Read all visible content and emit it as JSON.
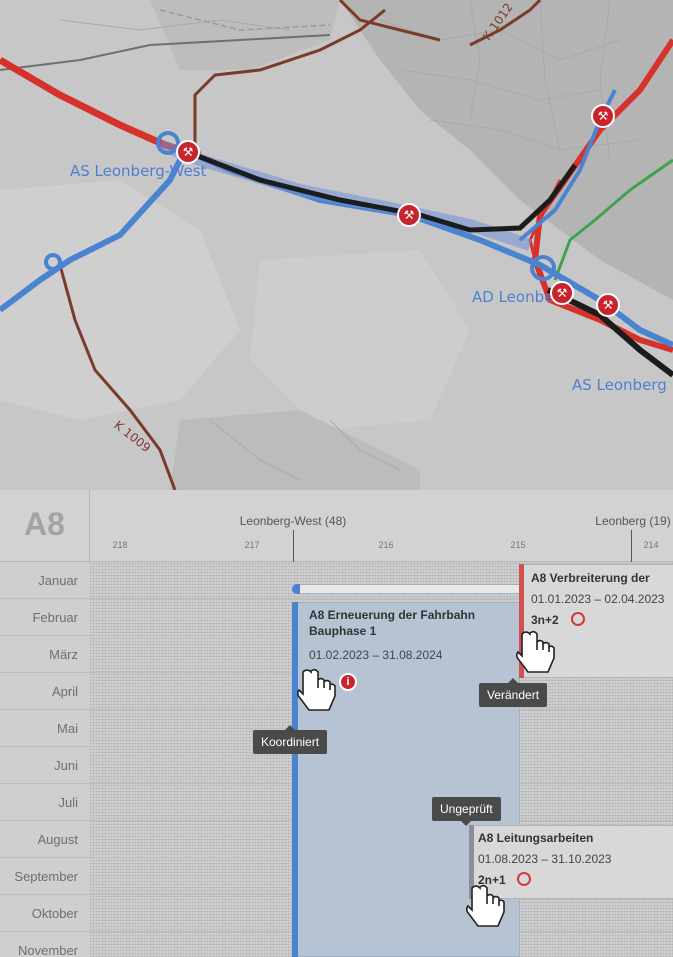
{
  "map": {
    "labels": {
      "as_leonberg_west": "AS Leonberg-West",
      "ad_leonberg": "AD Leonberg",
      "as_leonberg": "AS Leonberg"
    },
    "roads": {
      "k1009": "K 1009",
      "k1012": "K 1012"
    },
    "marker_icon": "roadworks-icon",
    "colors": {
      "closure": "#c9242c",
      "link": "#4a84d0",
      "route": "#1c1c1c",
      "detour": "#3fa34d",
      "road": "#7a3b2b"
    }
  },
  "timeline": {
    "highway": "A8",
    "junctions": [
      {
        "label": "Leonberg-West (48)"
      },
      {
        "label": "Leonberg (19)"
      }
    ],
    "km_marks": [
      "218",
      "217",
      "216",
      "215",
      "214"
    ],
    "months": [
      "Januar",
      "Februar",
      "März",
      "April",
      "Mai",
      "Juni",
      "Juli",
      "August",
      "September",
      "Oktober",
      "November"
    ],
    "works": [
      {
        "title_line1": "A8 Erneuerung der Fahrbahn",
        "title_line2": "Bauphase 1",
        "dates": "01.02.2023 – 31.08.2024",
        "status": "Koordiniert",
        "badge": "i"
      },
      {
        "title": "A8 Verbreiterung der",
        "dates": "01.01.2023 – 02.04.2023",
        "lanes": "3n+2",
        "status": "Verändert"
      },
      {
        "title": "A8 Leitungsarbeiten",
        "dates": "01.08.2023 – 31.10.2023",
        "lanes": "2n+1",
        "status": "Ungeprüft"
      }
    ]
  }
}
